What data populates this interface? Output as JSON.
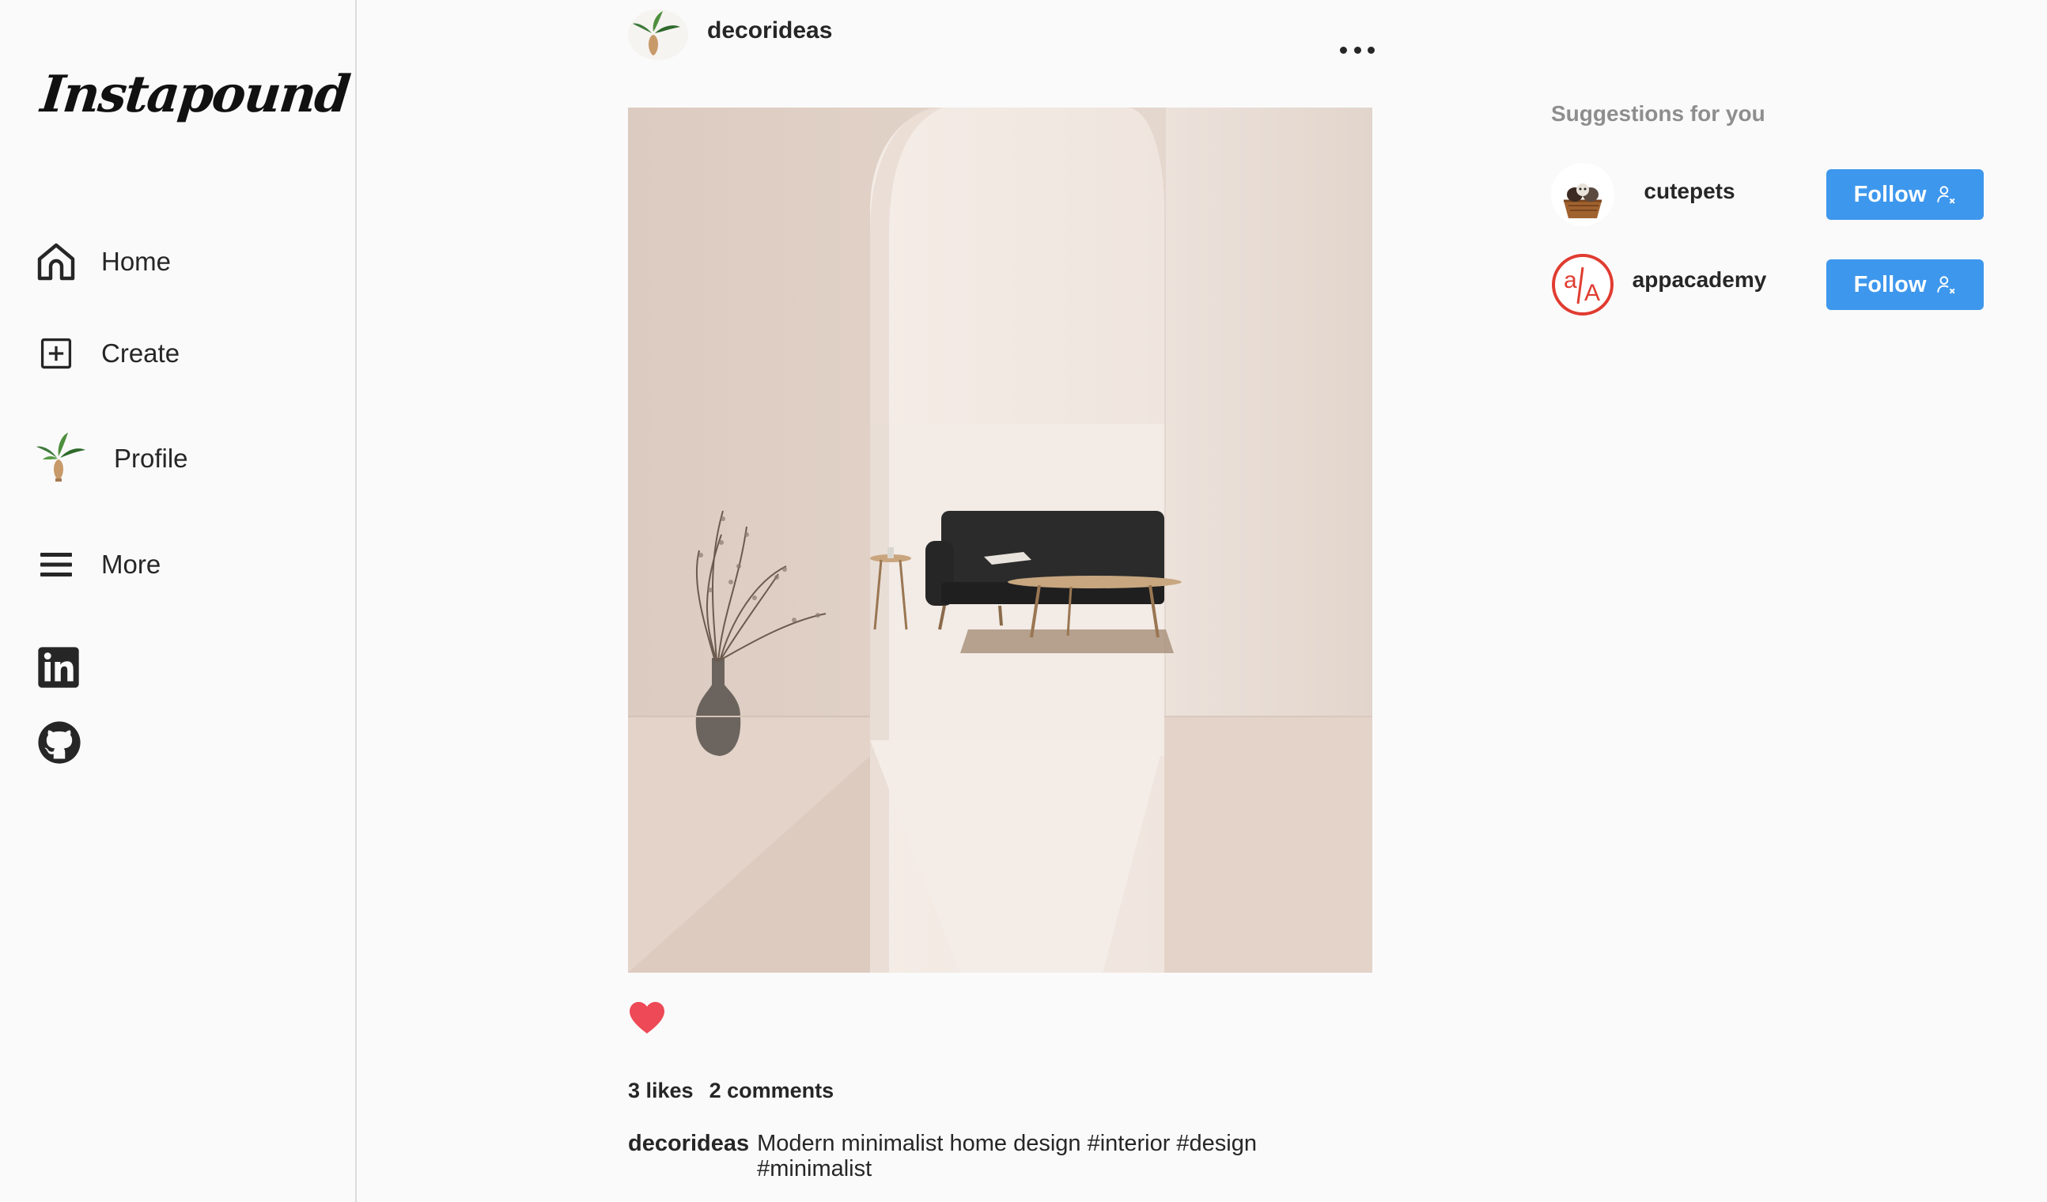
{
  "app": {
    "logo": "Instapound"
  },
  "sidebar": {
    "items": [
      {
        "label": "Home",
        "icon": "home-icon"
      },
      {
        "label": "Create",
        "icon": "plus-square-icon"
      },
      {
        "label": "Profile",
        "icon": "profile-avatar"
      },
      {
        "label": "More",
        "icon": "hamburger-icon"
      }
    ],
    "social": [
      "linkedin-icon",
      "github-icon"
    ]
  },
  "post": {
    "username": "decorideas",
    "likes": "3 likes",
    "comments": "2 comments",
    "caption_user": "decorideas",
    "caption": "Modern minimalist home design #interior #design #minimalist",
    "liked": true
  },
  "suggestions": {
    "title": "Suggestions for you",
    "users": [
      {
        "username": "cutepets",
        "button": "Follow"
      },
      {
        "username": "appacademy",
        "button": "Follow"
      }
    ]
  },
  "colors": {
    "accent": "#3d97ed",
    "like": "#ed4956",
    "border": "#dbdbdb",
    "muted": "#8e8e8e"
  }
}
